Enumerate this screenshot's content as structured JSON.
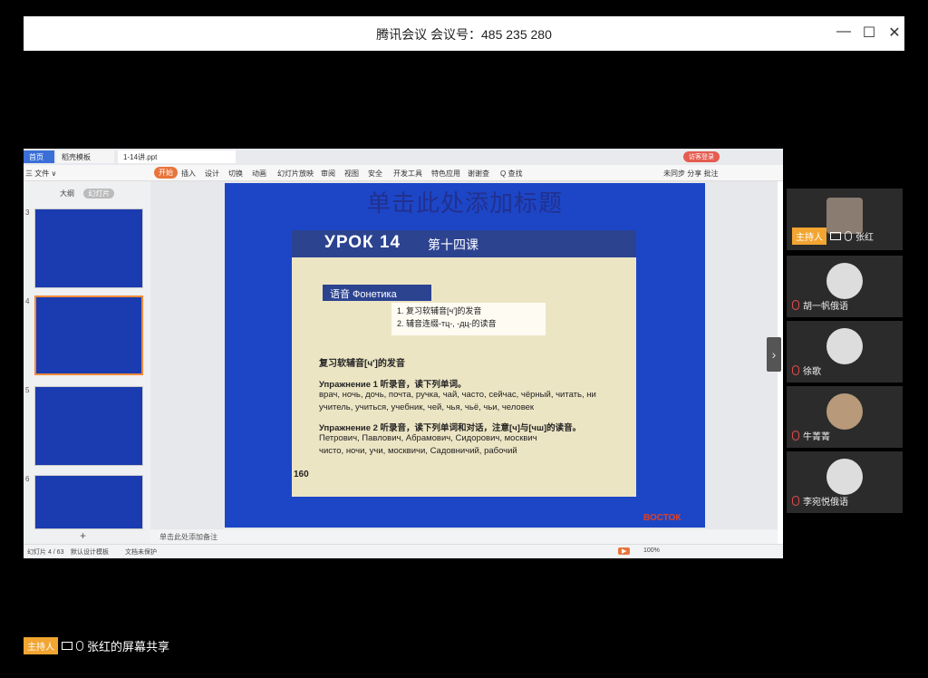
{
  "window": {
    "title": "腾讯会议 会议号：485 235 280",
    "minimize": "—",
    "maximize": "☐",
    "close": "✕"
  },
  "wps": {
    "tabs": [
      "首页",
      "稻壳模板",
      "1-14讲.ppt"
    ],
    "menu": [
      "三 文件 ∨",
      "开始",
      "插入",
      "设计",
      "切换",
      "动画",
      "幻灯片放映",
      "审阅",
      "视图",
      "安全",
      "开发工具",
      "特色应用",
      "谢谢查",
      "Q 查找"
    ],
    "login": "访客登录",
    "right_tools": "未同步  分享  批注"
  },
  "thumbs": {
    "tab_outline": "大纲",
    "tab_slides": "幻灯片",
    "numbers": [
      "3",
      "4",
      "5",
      "6"
    ],
    "add": "+"
  },
  "slide": {
    "placeholder": "单击此处添加标题",
    "lesson": "УРОК 14",
    "lesson_cn": "第十四课",
    "topic": "语音 Фонетика",
    "paper_line1": "1. 复习软辅音[ч']的发音",
    "paper_line2": "2. 辅音连缀-тц-, -дц-的读音",
    "section": "复习软辅音[ч']的发音",
    "ex1_title": "Упражнение 1 听录音，读下列单词。",
    "ex1_l1": "врач, ночь, дочь, почта, ручка, чай, часто, сейчас, чёрный, читать, ни",
    "ex1_l2": "учитель, учиться, учебник, чей, чья, чьё, чьи, человек",
    "ex2_title": "Упражнение 2 听录音，读下列单词和对话，注意[ч]与[чш]的读音。",
    "ex2_l1": "Петрович, Павлович, Абрамович, Сидорович, москвич",
    "ex2_l2": "чисто, ночи, учи, москвичи, Садовничий, рабочий",
    "page": "160",
    "brand": "ВОСТОК"
  },
  "notes": "单击此处添加备注",
  "status": {
    "slide_count": "幻灯片 4 / 63",
    "theme": "默认设计模板",
    "backup": "文档未保护",
    "zoom": "100%"
  },
  "participants": [
    {
      "name": "张红",
      "host": true,
      "badge": "主持人",
      "muted": false
    },
    {
      "name": "胡一帆俄语",
      "host": false,
      "muted": true
    },
    {
      "name": "徐歌",
      "host": false,
      "muted": true
    },
    {
      "name": "牛菁菁",
      "host": false,
      "muted": true
    },
    {
      "name": "李宛悦俄语",
      "host": false,
      "muted": true
    }
  ],
  "bottom": {
    "badge": "主持人",
    "text": "张红的屏幕共享"
  },
  "colors": {
    "slide_blue": "#1c46c6",
    "book_header": "#2c4390",
    "accent_orange": "#e8743b",
    "host_badge": "#f2a531"
  }
}
